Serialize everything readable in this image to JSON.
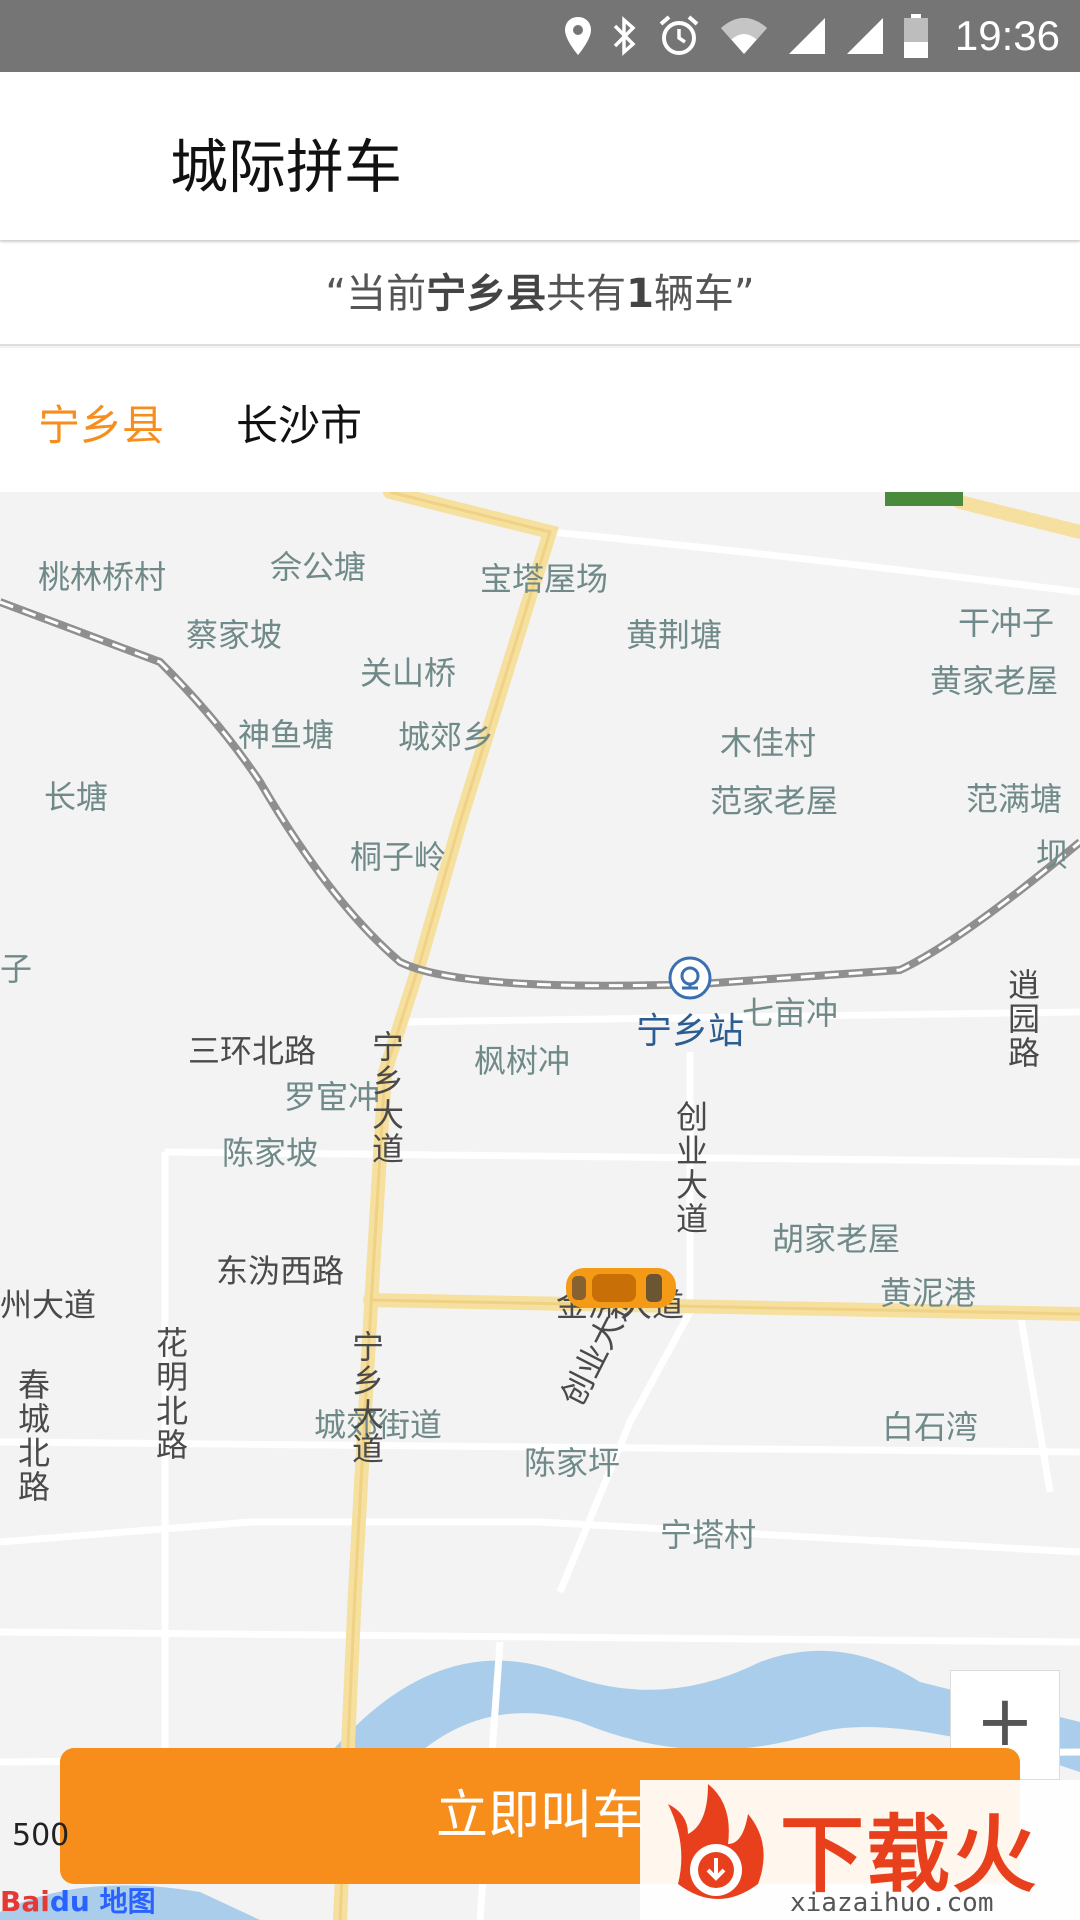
{
  "status_bar": {
    "time": "19:36",
    "icons": [
      "location-icon",
      "bluetooth-icon",
      "alarm-icon",
      "wifi-icon",
      "signal-icon",
      "signal-icon",
      "battery-icon"
    ]
  },
  "app_bar": {
    "title": "城际拼车"
  },
  "notice": {
    "prefix": "“当前",
    "county": "宁乡县",
    "middle": "共有",
    "count": "1",
    "suffix": "辆车”"
  },
  "tabs": [
    {
      "label": "宁乡县",
      "active": true,
      "color": "#f68e1e"
    },
    {
      "label": "长沙市",
      "active": false
    }
  ],
  "map": {
    "places": [
      "桃林桥村",
      "佘公塘",
      "宝塔屋场",
      "黄荆塘",
      "干冲子",
      "蔡家坡",
      "关山桥",
      "黄家老屋",
      "神鱼塘",
      "城郊乡",
      "木佳村",
      "长塘",
      "范家老屋",
      "范满塘",
      "坝",
      "桐子岭",
      "子",
      "七亩冲",
      "枫树冲",
      "罗宦冲",
      "陈家坡",
      "胡家老屋",
      "黄泥港",
      "城郊街道",
      "白石湾",
      "陈家坪",
      "宁塔村"
    ],
    "roads": [
      "三环北路",
      "宁乡大道",
      "宁乡大道",
      "创业大道",
      "创业大道",
      "金洲大道",
      "州大道",
      "花明北路",
      "春城北路",
      "东沩西路",
      "逍园路"
    ],
    "station": "宁乡站",
    "scale": "500",
    "logo_left": "Bai",
    "logo_right": "du 地图"
  },
  "zoom_in": "+",
  "call_button": "立即叫车",
  "watermark": {
    "brand": "下载火",
    "url": "xiazaihuo.com"
  },
  "colors": {
    "accent": "#f78d1a",
    "status_bar": "#757575"
  }
}
